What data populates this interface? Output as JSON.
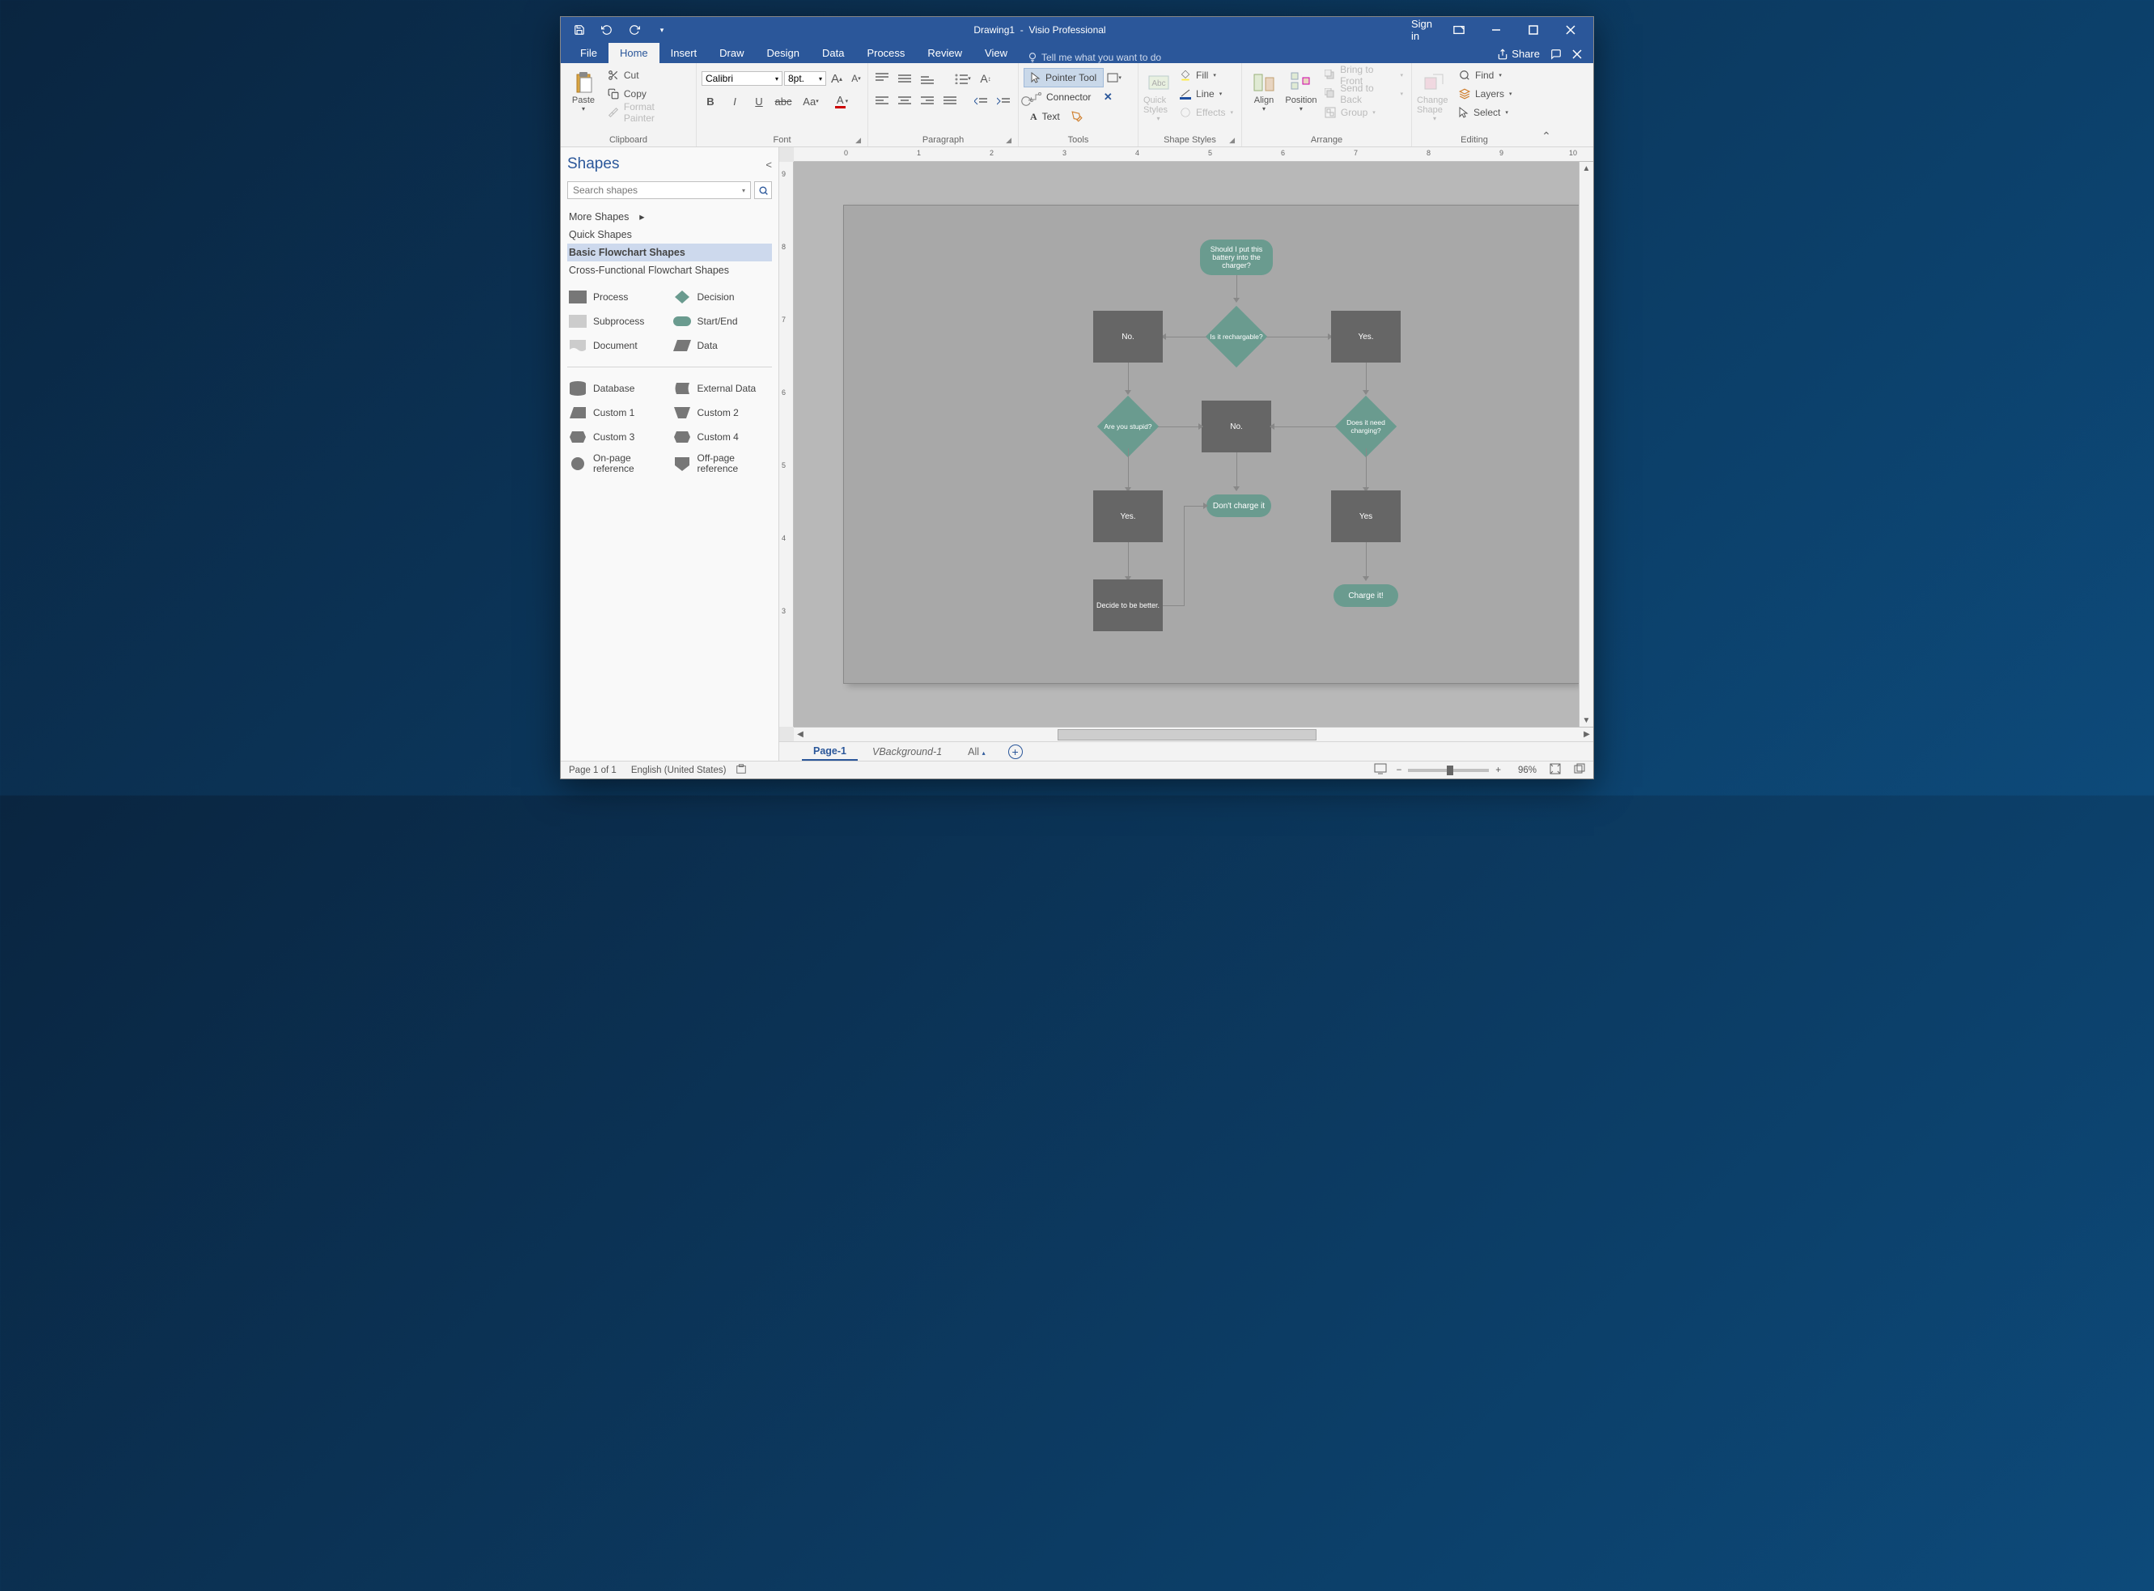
{
  "titlebar": {
    "document": "Drawing1",
    "app": "Visio Professional",
    "signin": "Sign in"
  },
  "menutabs": [
    "File",
    "Home",
    "Insert",
    "Draw",
    "Design",
    "Data",
    "Process",
    "Review",
    "View"
  ],
  "menutab_active": 1,
  "tellme": "Tell me what you want to do",
  "share": "Share",
  "ribbon": {
    "clipboard": {
      "paste": "Paste",
      "cut": "Cut",
      "copy": "Copy",
      "format_painter": "Format Painter",
      "label": "Clipboard"
    },
    "font": {
      "name": "Calibri",
      "size": "8pt.",
      "label": "Font"
    },
    "paragraph": {
      "label": "Paragraph"
    },
    "tools": {
      "pointer": "Pointer Tool",
      "connector": "Connector",
      "text": "Text",
      "label": "Tools"
    },
    "shapestyles": {
      "fill": "Fill",
      "line": "Line",
      "effects": "Effects",
      "quick": "Quick Styles",
      "label": "Shape Styles"
    },
    "arrange": {
      "align": "Align",
      "position": "Position",
      "bring_front": "Bring to Front",
      "send_back": "Send to Back",
      "group": "Group",
      "label": "Arrange"
    },
    "editing": {
      "change_shape": "Change Shape",
      "find": "Find",
      "layers": "Layers",
      "select": "Select",
      "label": "Editing"
    }
  },
  "shapespane": {
    "title": "Shapes",
    "search_placeholder": "Search shapes",
    "more_shapes": "More Shapes",
    "stencils": [
      "Quick Shapes",
      "Basic Flowchart Shapes",
      "Cross-Functional Flowchart Shapes"
    ],
    "stencil_selected": 1,
    "shapes1": [
      {
        "name": "Process",
        "icon": "process"
      },
      {
        "name": "Decision",
        "icon": "decision"
      },
      {
        "name": "Subprocess",
        "icon": "subprocess"
      },
      {
        "name": "Start/End",
        "icon": "terminator"
      },
      {
        "name": "Document",
        "icon": "document"
      },
      {
        "name": "Data",
        "icon": "data"
      }
    ],
    "shapes2": [
      {
        "name": "Database",
        "icon": "database"
      },
      {
        "name": "External Data",
        "icon": "extdata"
      },
      {
        "name": "Custom 1",
        "icon": "custom1"
      },
      {
        "name": "Custom 2",
        "icon": "custom2"
      },
      {
        "name": "Custom 3",
        "icon": "custom3"
      },
      {
        "name": "Custom 4",
        "icon": "custom4"
      },
      {
        "name": "On-page reference",
        "icon": "onpage"
      },
      {
        "name": "Off-page reference",
        "icon": "offpage"
      }
    ]
  },
  "flowchart": {
    "start": "Should I put this battery into the charger?",
    "dec1": "Is it rechargable?",
    "no1": "No.",
    "yes1": "Yes.",
    "dec2": "Are you stupid?",
    "no2": "No.",
    "dec3": "Does it need charging?",
    "yes2": "Yes.",
    "term1": "Don't charge it",
    "yes3": "Yes",
    "decide": "Decide to be better.",
    "term2": "Charge it!"
  },
  "pagetabs": {
    "page1": "Page-1",
    "bg": "VBackground-1",
    "all": "All"
  },
  "status": {
    "page": "Page 1 of 1",
    "lang": "English (United States)",
    "zoom": "96%"
  },
  "ruler_h": [
    0,
    1,
    2,
    3,
    4,
    5,
    6,
    7,
    8,
    9,
    10
  ],
  "ruler_v": [
    9,
    8,
    7,
    6,
    5,
    4,
    3
  ]
}
